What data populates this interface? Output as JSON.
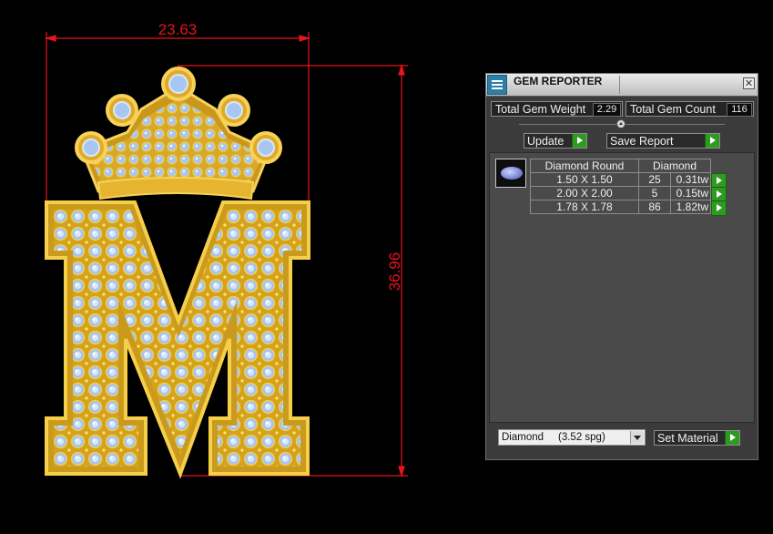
{
  "drawing": {
    "width_dimension": "23.63",
    "height_dimension": "36.96"
  },
  "gem_reporter": {
    "title": "GEM REPORTER",
    "close_label": "✕",
    "total_gem_weight_label": "Total Gem Weight",
    "total_gem_weight_value": "2.29",
    "total_gem_count_label": "Total Gem Count",
    "total_gem_count_value": "116",
    "update_label": "Update",
    "save_report_label": "Save Report",
    "table": {
      "header": [
        "Diamond Round",
        "Diamond"
      ],
      "rows": [
        {
          "size": "1.50 X 1.50",
          "count": "25",
          "weight": "0.31tw"
        },
        {
          "size": "2.00 X 2.00",
          "count": "5",
          "weight": "0.15tw"
        },
        {
          "size": "1.78 X 1.78",
          "count": "86",
          "weight": "1.82tw"
        }
      ]
    },
    "material_select": "Diamond     (3.52 spg)",
    "set_material_label": "Set Material"
  },
  "colors": {
    "dimension_red": "#e8141b",
    "gold": "#f2c230",
    "gem_blue": "#a9c6f2",
    "play_green": "#2f9a22"
  }
}
